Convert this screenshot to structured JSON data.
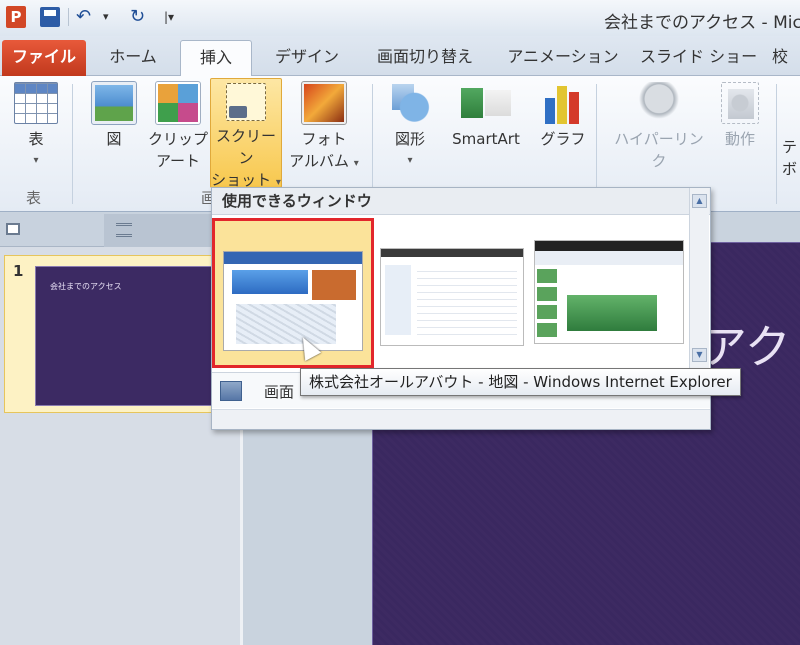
{
  "app": {
    "window_title": "会社までのアクセス - Micro",
    "icon_letter": "P"
  },
  "quick_access": {
    "undo_icon": "undo-icon",
    "redo_icon": "redo-icon",
    "save_icon": "save-icon",
    "dropdown": "▾",
    "customize": "|▾"
  },
  "tabs": {
    "file": "ファイル",
    "home": "ホーム",
    "insert": "挿入",
    "design": "デザイン",
    "transitions": "画面切り替え",
    "animations": "アニメーション",
    "slideshow": "スライド ショー",
    "more": "校"
  },
  "ribbon": {
    "table": {
      "label": "表",
      "caret": "▾",
      "group": "表"
    },
    "picture": {
      "label": "図"
    },
    "clipart": {
      "line1": "クリップ",
      "line2": "アート"
    },
    "screenshot": {
      "line1": "スクリーン",
      "line2": "ショット",
      "caret": "▾"
    },
    "photo_album": {
      "line1": "フォト",
      "line2": "アルバム",
      "caret": "▾"
    },
    "shapes": {
      "label": "図形",
      "caret": "▾"
    },
    "smartart": {
      "label": "SmartArt"
    },
    "graph": {
      "label": "グラフ"
    },
    "hyperlink": {
      "label": "ハイパーリンク"
    },
    "action": {
      "label": "動作"
    },
    "text_more": {
      "line1": "テ",
      "line2": "ボ"
    },
    "group_images_tail": "画"
  },
  "slides_pane": {
    "slide_number": "1",
    "thumb_title": "会社までのアクセス"
  },
  "main_slide": {
    "title_visible": "アク"
  },
  "gallery": {
    "header": "使用できるウィンドウ",
    "scroll_up": "▲",
    "scroll_down": "▼",
    "clipping_label": "画面",
    "tooltip": "株式会社オールアバウト - 地図 - Windows Internet Explorer"
  },
  "colors": {
    "file_tab": "#d24726",
    "slide_bg": "#3d2a62",
    "selection_border": "#e2262b",
    "hover_fill": "#f8c84e"
  }
}
